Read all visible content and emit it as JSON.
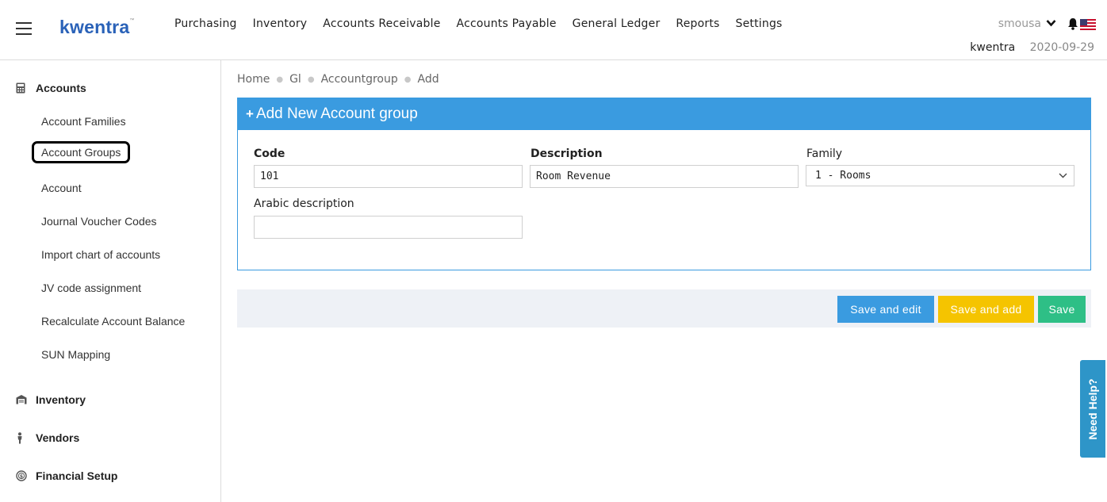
{
  "app": {
    "logo": "kwentra",
    "logo_mark": "™"
  },
  "nav": {
    "items": [
      "Purchasing",
      "Inventory",
      "Accounts Receivable",
      "Accounts Payable",
      "General Ledger",
      "Reports",
      "Settings"
    ]
  },
  "user": {
    "name": "smousa",
    "company": "kwentra",
    "date": "2020-09-29"
  },
  "sidebar": {
    "sections": [
      {
        "label": "Accounts",
        "icon": "calculator-icon"
      },
      {
        "label": "Inventory",
        "icon": "warehouse-icon"
      },
      {
        "label": "Vendors",
        "icon": "person-icon"
      },
      {
        "label": "Financial Setup",
        "icon": "coin-icon"
      }
    ],
    "accounts_items": [
      "Account Families",
      "Account Groups",
      "Account",
      "Journal Voucher Codes",
      "Import chart of accounts",
      "JV code assignment",
      "Recalculate Account Balance",
      "SUN Mapping"
    ],
    "active_item": "Account Groups"
  },
  "breadcrumb": [
    "Home",
    "Gl",
    "Accountgroup",
    "Add"
  ],
  "form": {
    "title": "Add New Account group",
    "code_label": "Code",
    "code_value": "101",
    "description_label": "Description",
    "description_value": "Room Revenue",
    "family_label": "Family",
    "family_value": "1 - Rooms",
    "arabic_label": "Arabic description",
    "arabic_value": ""
  },
  "actions": {
    "save_edit": "Save and edit",
    "save_add": "Save and add",
    "save": "Save"
  },
  "help": {
    "label": "Need Help?"
  },
  "colors": {
    "brand": "#2a62b8",
    "primary": "#3a9be0",
    "warning": "#f5c400",
    "success": "#2ebf86",
    "help": "#2e95c8"
  }
}
